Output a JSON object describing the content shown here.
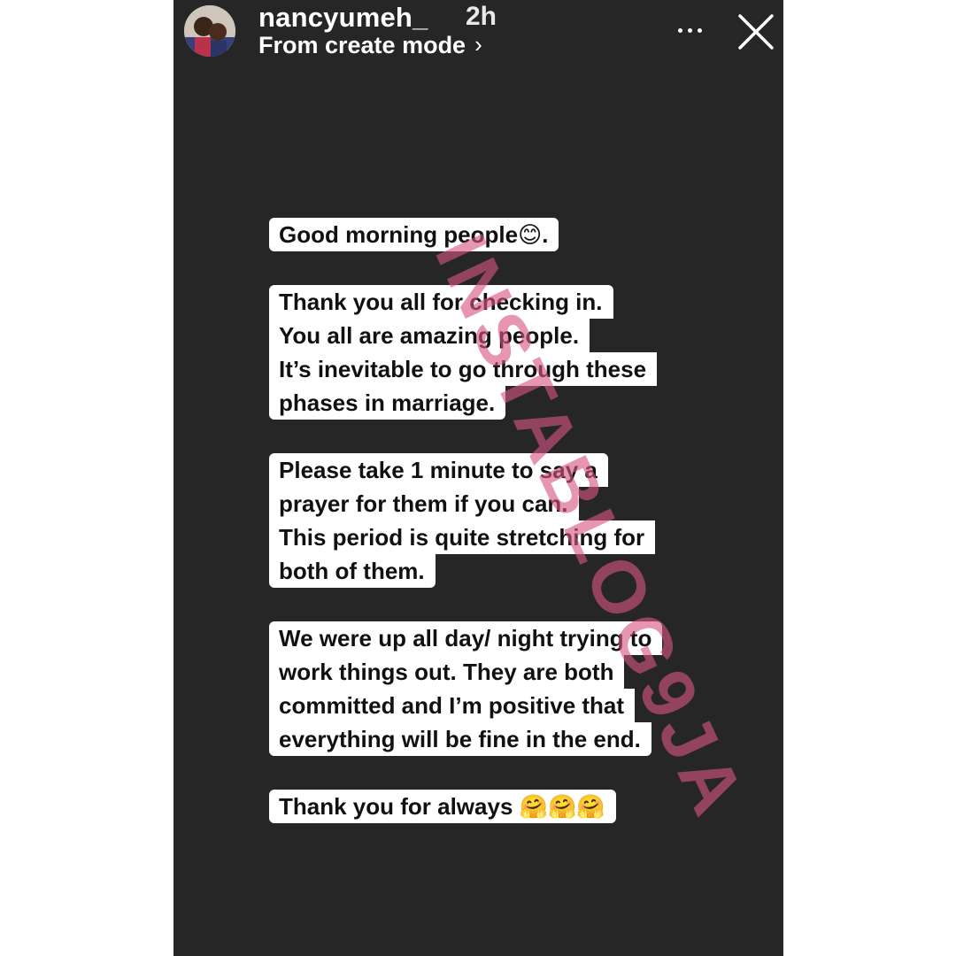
{
  "story": {
    "username": "nancyumeh_",
    "time_ago": "2h",
    "subtitle": "From create mode",
    "subtitle_chevron": "›",
    "icons": {
      "more": "more-horizontal-icon",
      "close": "close-icon",
      "chevron": "chevron-right-icon"
    },
    "paragraphs": [
      {
        "lines": [
          "Good morning people😊."
        ]
      },
      {
        "lines": [
          "Thank you all for checking in.",
          "You all are amazing people.",
          "It’s inevitable to go through these",
          "phases in marriage."
        ]
      },
      {
        "lines": [
          "Please take 1 minute to say a",
          "prayer for them if you can.",
          "This period is quite stretching for",
          "both of them."
        ]
      },
      {
        "lines": [
          "We were up all day/ night trying to",
          "work things out. They are both",
          "committed and I’m positive that",
          "everything will be fine in the end."
        ]
      },
      {
        "lines": [
          "Thank you for always 🤗🤗🤗"
        ]
      }
    ],
    "watermark": "INSTABLOG9JA",
    "colors": {
      "background": "#262626",
      "text_bg": "#ffffff",
      "watermark": "#d65684"
    }
  }
}
